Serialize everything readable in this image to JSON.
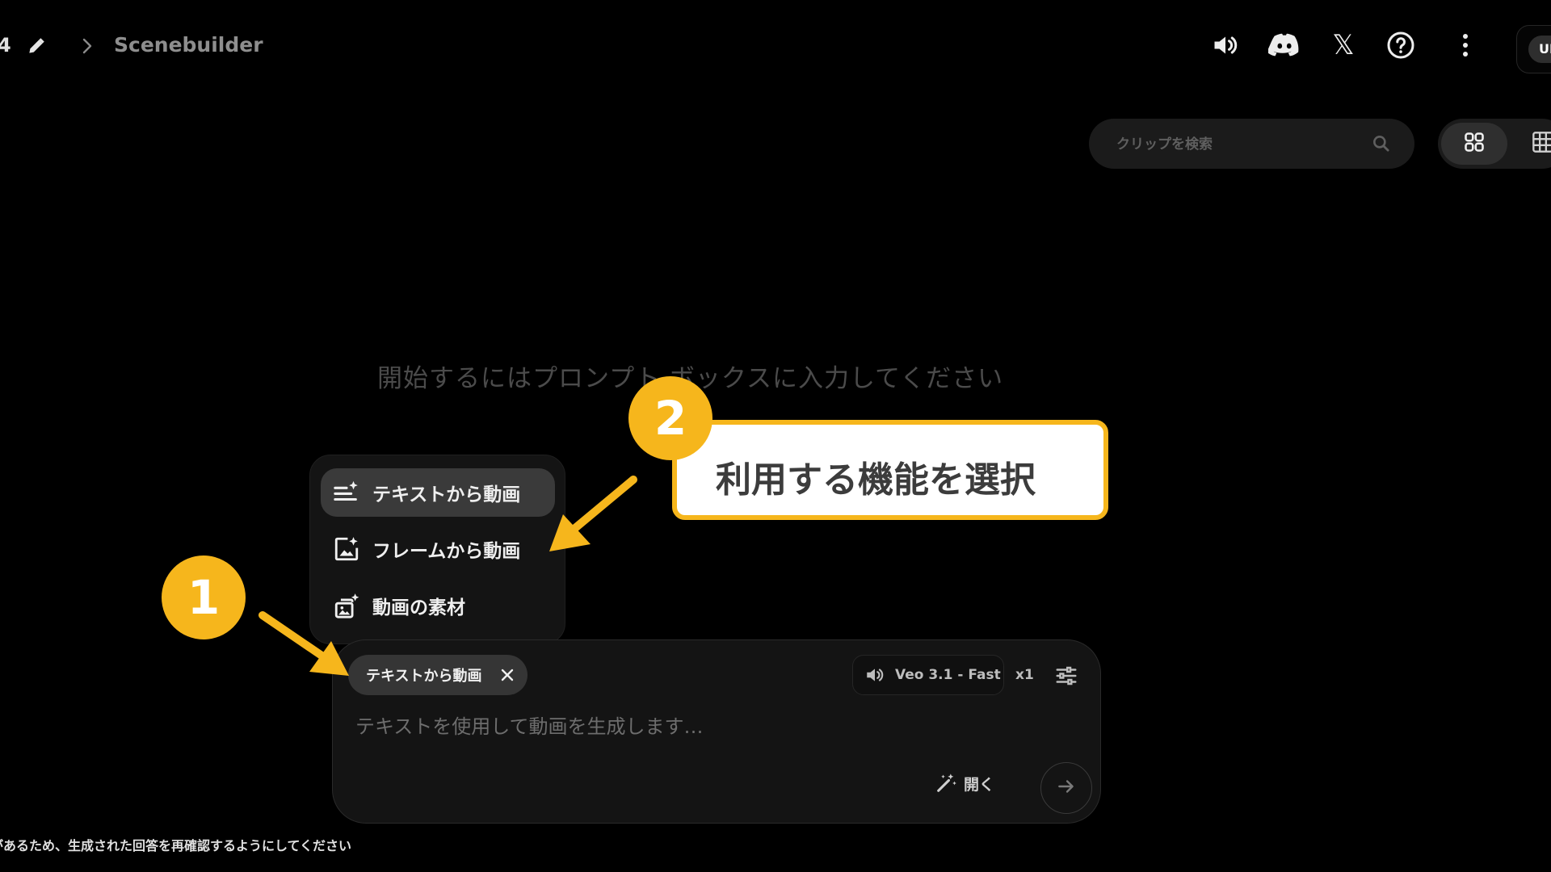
{
  "header": {
    "crumb_number": "4",
    "project_title": "Scenebuilder",
    "user_initials": "UL",
    "icons": [
      "pencil-icon",
      "chevron-right-icon",
      "volume-icon",
      "discord-icon",
      "x-icon",
      "help-icon",
      "more-vertical-icon"
    ],
    "x_glyph": "𝕏"
  },
  "search": {
    "placeholder": "クリップを検索"
  },
  "view_toggle": {
    "icons": [
      "grid-large-icon",
      "grid-small-icon"
    ]
  },
  "empty_state": {
    "hint": "開始するにはプロンプト ボックスに入力してください"
  },
  "mode_menu": {
    "items": [
      {
        "label": "テキストから動画",
        "icon": "text-sparkle-icon",
        "selected": true
      },
      {
        "label": "フレームから動画",
        "icon": "image-sparkle-icon",
        "selected": false
      },
      {
        "label": "動画の素材",
        "icon": "ingredients-icon",
        "selected": false
      }
    ]
  },
  "prompt": {
    "mode_chip_label": "テキストから動画",
    "model_label": "Veo 3.1 - Fast",
    "count_label": "x1",
    "placeholder": "テキストを使用して動画を生成します…",
    "open_label": "開く"
  },
  "footer": {
    "disclaimer": "があるため、生成された回答を再確認するようにしてください"
  },
  "annotations": {
    "step1": "1",
    "step2": "2",
    "callout": "利用する機能を選択",
    "accent_color": "#f6b61c"
  }
}
